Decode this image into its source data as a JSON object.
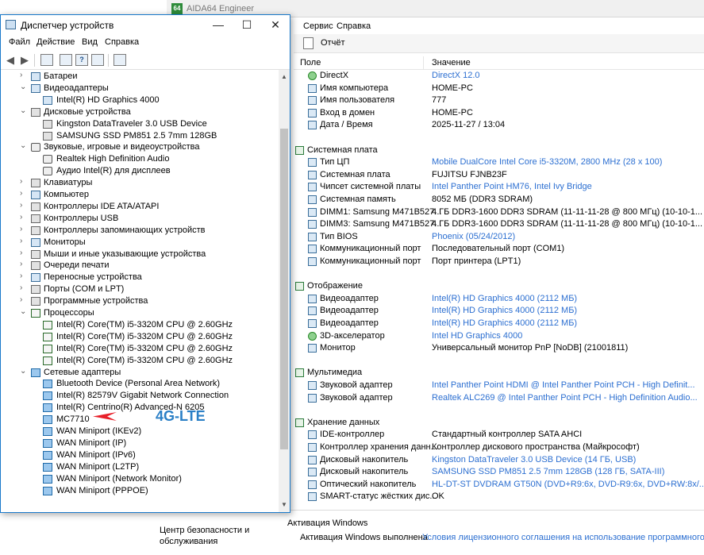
{
  "aida": {
    "title": "AIDA64 Engineer",
    "logo": "64",
    "menu": [
      "Сервис",
      "Справка"
    ],
    "toolbar": {
      "report_label": "Отчёт"
    },
    "columns": {
      "field": "Поле",
      "value": "Значение"
    },
    "rows": [
      {
        "type": "item",
        "icon": "xbox-icon",
        "label": "DirectX",
        "value": "DirectX 12.0",
        "link": true
      },
      {
        "type": "item",
        "icon": "computer-icon",
        "label": "Имя компьютера",
        "value": "HOME-PC",
        "link": false
      },
      {
        "type": "item",
        "icon": "user-icon",
        "label": "Имя пользователя",
        "value": "777",
        "link": false
      },
      {
        "type": "item",
        "icon": "domain-icon",
        "label": "Вход в домен",
        "value": "HOME-PC",
        "link": false
      },
      {
        "type": "item",
        "icon": "calendar-icon",
        "label": "Дата / Время",
        "value": "2025-11-27 / 13:04",
        "link": false
      },
      {
        "type": "blank"
      },
      {
        "type": "section",
        "icon": "motherboard-icon",
        "label": "Системная плата"
      },
      {
        "type": "item",
        "icon": "cpu-icon",
        "label": "Тип ЦП",
        "value": "Mobile DualCore Intel Core i5-3320M, 2800 MHz (28 x 100)",
        "link": true
      },
      {
        "type": "item",
        "icon": "motherboard-icon",
        "label": "Системная плата",
        "value": "FUJITSU FJNB23F",
        "link": false
      },
      {
        "type": "item",
        "icon": "chipset-icon",
        "label": "Чипсет системной платы",
        "value": "Intel Panther Point HM76, Intel Ivy Bridge",
        "link": true
      },
      {
        "type": "item",
        "icon": "memory-icon",
        "label": "Системная память",
        "value": "8052 МБ  (DDR3 SDRAM)",
        "link": false
      },
      {
        "type": "item",
        "icon": "memory-icon",
        "label": "DIMM1: Samsung M471B527...",
        "value": "4 ГБ DDR3-1600 DDR3 SDRAM  (11-11-11-28 @ 800 МГц)  (10-10-1...",
        "link": false
      },
      {
        "type": "item",
        "icon": "memory-icon",
        "label": "DIMM3: Samsung M471B527...",
        "value": "4 ГБ DDR3-1600 DDR3 SDRAM  (11-11-11-28 @ 800 МГц)  (10-10-1...",
        "link": false
      },
      {
        "type": "item",
        "icon": "bios-icon",
        "label": "Тип BIOS",
        "value": "Phoenix (05/24/2012)",
        "link": true
      },
      {
        "type": "item",
        "icon": "port-icon",
        "label": "Коммуникационный порт",
        "value": "Последовательный порт (COM1)",
        "link": false
      },
      {
        "type": "item",
        "icon": "port-icon",
        "label": "Коммуникационный порт",
        "value": "Порт принтера (LPT1)",
        "link": false
      },
      {
        "type": "blank"
      },
      {
        "type": "section",
        "icon": "display-icon",
        "label": "Отображение"
      },
      {
        "type": "item",
        "icon": "gpu-icon",
        "label": "Видеоадаптер",
        "value": "Intel(R) HD Graphics 4000  (2112 МБ)",
        "link": true
      },
      {
        "type": "item",
        "icon": "gpu-icon",
        "label": "Видеоадаптер",
        "value": "Intel(R) HD Graphics 4000  (2112 МБ)",
        "link": true
      },
      {
        "type": "item",
        "icon": "gpu-icon",
        "label": "Видеоадаптер",
        "value": "Intel(R) HD Graphics 4000  (2112 МБ)",
        "link": true
      },
      {
        "type": "item",
        "icon": "xbox-icon",
        "label": "3D-акселератор",
        "value": "Intel HD Graphics 4000",
        "link": true
      },
      {
        "type": "item",
        "icon": "monitor-icon",
        "label": "Монитор",
        "value": "Универсальный монитор PnP [NoDB]  (21001811)",
        "link": false
      },
      {
        "type": "blank"
      },
      {
        "type": "section",
        "icon": "speaker-icon",
        "label": "Мультимедиа"
      },
      {
        "type": "item",
        "icon": "sound-icon",
        "label": "Звуковой адаптер",
        "value": "Intel Panther Point HDMI @ Intel Panther Point PCH - High Definit...",
        "link": true
      },
      {
        "type": "item",
        "icon": "sound-icon",
        "label": "Звуковой адаптер",
        "value": "Realtek ALC269 @ Intel Panther Point PCH - High Definition Audio...",
        "link": true
      },
      {
        "type": "blank"
      },
      {
        "type": "section",
        "icon": "storage-icon",
        "label": "Хранение данных"
      },
      {
        "type": "item",
        "icon": "ide-icon",
        "label": "IDE-контроллер",
        "value": "Стандартный контроллер SATA AHCI",
        "link": false
      },
      {
        "type": "item",
        "icon": "storage-controller-icon",
        "label": "Контроллер хранения данн...",
        "value": "Контроллер дискового пространства (Майкрософт)",
        "link": false
      },
      {
        "type": "item",
        "icon": "disk-icon",
        "label": "Дисковый накопитель",
        "value": "Kingston DataTraveler 3.0 USB Device  (14 ГБ, USB)",
        "link": true
      },
      {
        "type": "item",
        "icon": "disk-icon",
        "label": "Дисковый накопитель",
        "value": "SAMSUNG SSD PM851 2.5 7mm 128GB  (128 ГБ, SATA-III)",
        "link": true
      },
      {
        "type": "item",
        "icon": "optical-drive-icon",
        "label": "Оптический накопитель",
        "value": "HL-DT-ST DVDRAM GT50N  (DVD+R9:6x, DVD-R9:6x, DVD+RW:8x/...",
        "link": true
      },
      {
        "type": "item",
        "icon": "smart-icon",
        "label": "SMART-статус жёстких дис...",
        "value": "OK",
        "link": false
      }
    ],
    "status": {
      "security_center": "Центр безопасности и обслуживания",
      "activation_heading": "Активация Windows",
      "activation_text": "Активация Windows выполнена",
      "activation_link": "Условия лицензионного соглашения на использование программного обесп"
    }
  },
  "devmgr": {
    "title": "Диспетчер устройств",
    "menu": [
      "Файл",
      "Действие",
      "Вид",
      "Справка"
    ],
    "caption": {
      "minimize": "—",
      "maximize": "☐",
      "close": "✕"
    },
    "tree": [
      {
        "level": 0,
        "expanded": false,
        "icon": "battery-icon",
        "label": "Батареи"
      },
      {
        "level": 0,
        "expanded": true,
        "icon": "display-adapter-icon",
        "label": "Видеоадаптеры"
      },
      {
        "level": 1,
        "icon": "display-adapter-icon",
        "label": "Intel(R) HD Graphics 4000"
      },
      {
        "level": 0,
        "expanded": true,
        "icon": "disk-icon",
        "label": "Дисковые устройства"
      },
      {
        "level": 1,
        "icon": "disk-icon",
        "label": "Kingston DataTraveler 3.0 USB Device"
      },
      {
        "level": 1,
        "icon": "disk-icon",
        "label": "SAMSUNG SSD PM851 2.5 7mm 128GB"
      },
      {
        "level": 0,
        "expanded": true,
        "icon": "sound-icon",
        "label": "Звуковые, игровые и видеоустройства"
      },
      {
        "level": 1,
        "icon": "sound-icon",
        "label": "Realtek High Definition Audio"
      },
      {
        "level": 1,
        "icon": "sound-icon",
        "label": "Аудио Intel(R) для дисплеев"
      },
      {
        "level": 0,
        "expanded": false,
        "icon": "keyboard-icon",
        "label": "Клавиатуры"
      },
      {
        "level": 0,
        "expanded": false,
        "icon": "computer-icon",
        "label": "Компьютер"
      },
      {
        "level": 0,
        "expanded": false,
        "icon": "ide-controller-icon",
        "label": "Контроллеры IDE ATA/ATAPI"
      },
      {
        "level": 0,
        "expanded": false,
        "icon": "usb-icon",
        "label": "Контроллеры USB"
      },
      {
        "level": 0,
        "expanded": false,
        "icon": "storage-controller-icon",
        "label": "Контроллеры запоминающих устройств"
      },
      {
        "level": 0,
        "expanded": false,
        "icon": "monitor-icon",
        "label": "Мониторы"
      },
      {
        "level": 0,
        "expanded": false,
        "icon": "mouse-icon",
        "label": "Мыши и иные указывающие устройства"
      },
      {
        "level": 0,
        "expanded": false,
        "icon": "print-queue-icon",
        "label": "Очереди печати"
      },
      {
        "level": 0,
        "expanded": false,
        "icon": "portable-device-icon",
        "label": "Переносные устройства"
      },
      {
        "level": 0,
        "expanded": false,
        "icon": "port-icon",
        "label": "Порты (COM и LPT)"
      },
      {
        "level": 0,
        "expanded": false,
        "icon": "software-device-icon",
        "label": "Программные устройства"
      },
      {
        "level": 0,
        "expanded": true,
        "icon": "cpu-icon",
        "label": "Процессоры"
      },
      {
        "level": 1,
        "icon": "cpu-icon",
        "label": "Intel(R) Core(TM) i5-3320M CPU @ 2.60GHz"
      },
      {
        "level": 1,
        "icon": "cpu-icon",
        "label": "Intel(R) Core(TM) i5-3320M CPU @ 2.60GHz"
      },
      {
        "level": 1,
        "icon": "cpu-icon",
        "label": "Intel(R) Core(TM) i5-3320M CPU @ 2.60GHz"
      },
      {
        "level": 1,
        "icon": "cpu-icon",
        "label": "Intel(R) Core(TM) i5-3320M CPU @ 2.60GHz"
      },
      {
        "level": 0,
        "expanded": true,
        "icon": "network-adapter-icon",
        "label": "Сетевые адаптеры"
      },
      {
        "level": 1,
        "icon": "network-adapter-icon",
        "label": "Bluetooth Device (Personal Area Network)"
      },
      {
        "level": 1,
        "icon": "network-adapter-icon",
        "label": "Intel(R) 82579V Gigabit Network Connection"
      },
      {
        "level": 1,
        "icon": "network-adapter-icon",
        "label": "Intel(R) Centrino(R) Advanced-N 6205"
      },
      {
        "level": 1,
        "icon": "network-adapter-icon",
        "label": "MC7710"
      },
      {
        "level": 1,
        "icon": "network-adapter-icon",
        "label": "WAN Miniport (IKEv2)"
      },
      {
        "level": 1,
        "icon": "network-adapter-icon",
        "label": "WAN Miniport (IP)"
      },
      {
        "level": 1,
        "icon": "network-adapter-icon",
        "label": "WAN Miniport (IPv6)"
      },
      {
        "level": 1,
        "icon": "network-adapter-icon",
        "label": "WAN Miniport (L2TP)"
      },
      {
        "level": 1,
        "icon": "network-adapter-icon",
        "label": "WAN Miniport (Network Monitor)"
      },
      {
        "level": 1,
        "icon": "network-adapter-icon",
        "label": "WAN Miniport (PPPOE)"
      }
    ],
    "annotation": {
      "text": "4G-LTE",
      "color": "#2a7fc6",
      "arrow_color": "#e8202a"
    }
  }
}
